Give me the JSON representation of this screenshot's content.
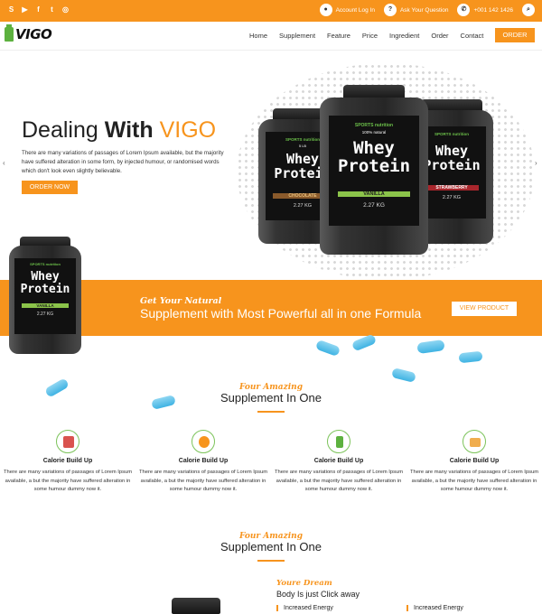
{
  "topbar": {
    "social_icons": [
      "skype-icon",
      "youtube-icon",
      "facebook-icon",
      "twitter-icon",
      "instagram-icon"
    ],
    "account_label": "Account Log In",
    "question_label": "Ask Your Question",
    "phone": "+001 142 1426"
  },
  "nav": {
    "logo": "VIGO",
    "menu": [
      "Home",
      "Supplement",
      "Feature",
      "Price",
      "Ingredient",
      "Order",
      "Contact"
    ],
    "order_label": "ORDER"
  },
  "hero": {
    "title_plain": "Dealing ",
    "title_bold": "With ",
    "title_accent": "VIGO",
    "description": "There are many variations of passages of Lorem Ipsum available, but the majority have suffered alteration in some form, by injected humour, or randomised words which don't look even slightly believable.",
    "button": "ORDER NOW",
    "prev_arrow": "‹",
    "next_arrow": "›"
  },
  "products": {
    "brand": "SPORTS nutrition",
    "name_line1": "Whey",
    "name_line2": "Protein",
    "weight": "2.27 KG",
    "flavors": [
      "CHOCOLATE",
      "VANILLA",
      "STRAWBERRY",
      "VANILLA"
    ],
    "badge": "5 LB",
    "natural": "100% natural"
  },
  "band": {
    "subtitle": "Get Your Natural",
    "title": "Supplement with Most Powerful all in one Formula",
    "button": "VIEW PRODUCT"
  },
  "section1": {
    "subtitle": "Four Amazing",
    "title": "Supplement In One"
  },
  "features": [
    {
      "title": "Calorie Build Up",
      "desc": "There are many variations of passages of Lorem Ipsum available, a but the majority have suffered alteration in some humour dummy now it."
    },
    {
      "title": "Calorie Build Up",
      "desc": "There are many variations of passages of Lorem Ipsum available, a but the majority have suffered alteration in some humour dummy now it."
    },
    {
      "title": "Calorie Build Up",
      "desc": "There are many variations of passages of Lorem Ipsum available, a but the majority have suffered alteration in some humour dummy now it."
    },
    {
      "title": "Calorie Build Up",
      "desc": "There are many variations of passages of Lorem Ipsum available, a but the majority have suffered alteration in some humour dummy now it."
    }
  ],
  "section2": {
    "subtitle": "Four Amazing",
    "title": "Supplement In One"
  },
  "dream": {
    "subtitle": "Youre Dream",
    "title": "Body Is just Click away",
    "items": [
      "Increased Energy",
      "Increased Energy"
    ]
  },
  "colors": {
    "accent": "#f7941d",
    "green": "#5db13f",
    "pill": "#4ab8e6"
  }
}
